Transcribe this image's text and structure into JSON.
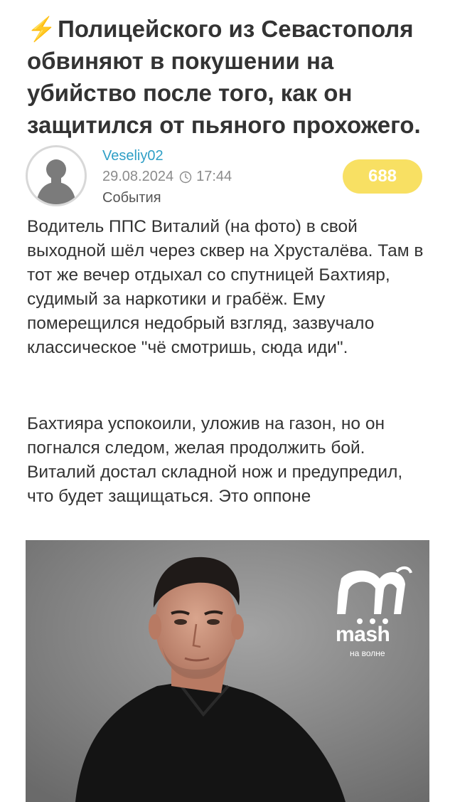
{
  "headline": {
    "icon": "lightning-icon",
    "emoji": "⚡",
    "text": "Полицейского из Севастополя обвиняют в покушении на убийство после того, как он защитился от пьяного прохожего."
  },
  "author": {
    "name": "Veseliy02",
    "date": "29.08.2024",
    "time": "17:44",
    "category": "События",
    "avatar_icon": "user-avatar-icon",
    "clock_icon": "clock-icon"
  },
  "views": "688",
  "body": {
    "paragraph1": "Водитель ППС Виталий (на фото) в свой выходной шёл через сквер на Хрусталёва. Там в тот же вечер отдыхал со спутницей Бахтияр, судимый за наркотики и грабёж. Ему померещился недобрый взгляд, зазвучало классическое \"чё смотришь, сюда иди\".",
    "paragraph2": "Бахтияра успокоили, уложив на газон, но он погнался следом, желая продолжить бой. Виталий достал складной нож и предупредил, что будет защищаться. Это оппоне"
  },
  "photo": {
    "watermark_brand": "mash",
    "watermark_sub": "на волне"
  },
  "colors": {
    "accent_link": "#2f9fc6",
    "badge_bg": "#f8e063",
    "bolt": "#f5b400"
  }
}
